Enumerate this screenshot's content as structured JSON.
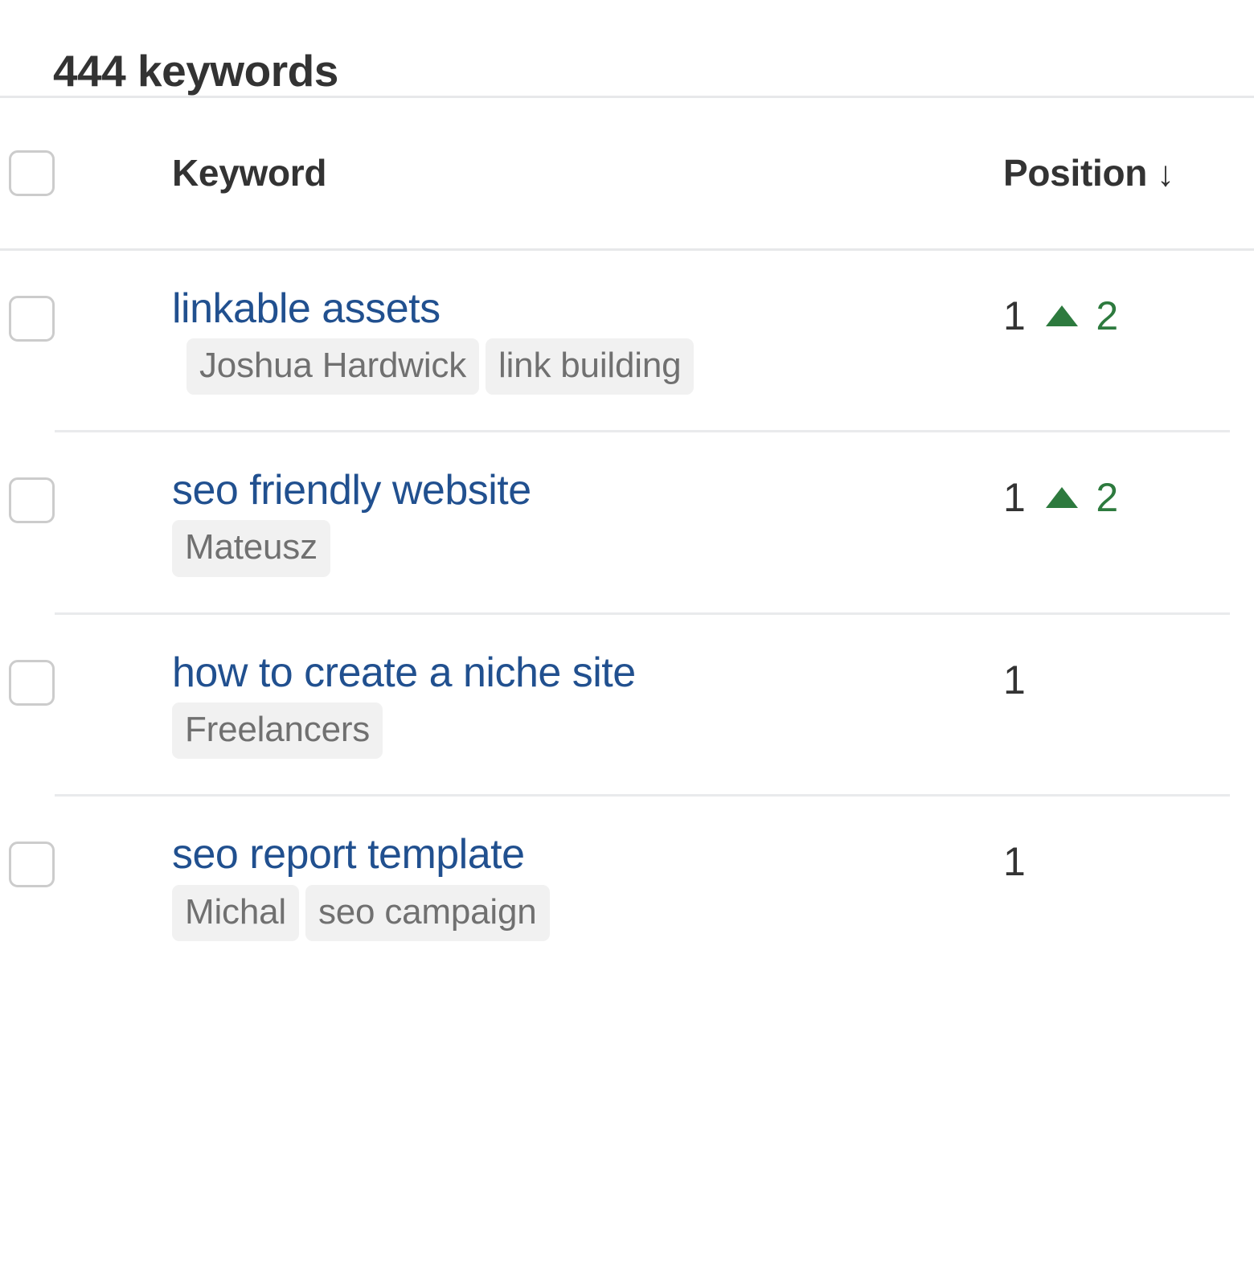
{
  "header": {
    "title": "444 keywords"
  },
  "table": {
    "columns": {
      "keyword": "Keyword",
      "position": "Position",
      "sort_arrow": "↓"
    },
    "rows": [
      {
        "keyword": "linkable assets",
        "tags": [
          "Joshua Hardwick",
          "link building"
        ],
        "position": "1",
        "change": "2",
        "change_direction": "up",
        "change_color": "#2d7a3e"
      },
      {
        "keyword": "seo friendly website",
        "tags": [
          "Mateusz"
        ],
        "position": "1",
        "change": "2",
        "change_direction": "up",
        "change_color": "#2d7a3e"
      },
      {
        "keyword": "how to create a niche site",
        "tags": [
          "Freelancers"
        ],
        "position": "1",
        "change": "",
        "change_direction": "none",
        "change_color": "#2d7a3e"
      },
      {
        "keyword": "seo report template",
        "tags": [
          "Michal",
          "seo campaign"
        ],
        "position": "1",
        "change": "",
        "change_direction": "none",
        "change_color": "#2d7a3e"
      }
    ]
  },
  "colors": {
    "link": "#21508f",
    "text": "#333333",
    "tag_bg": "#f1f1f1",
    "tag_text": "#707070",
    "divider": "#e7e8ea",
    "checkbox_border": "#cccccc",
    "positive": "#2d7a3e"
  }
}
